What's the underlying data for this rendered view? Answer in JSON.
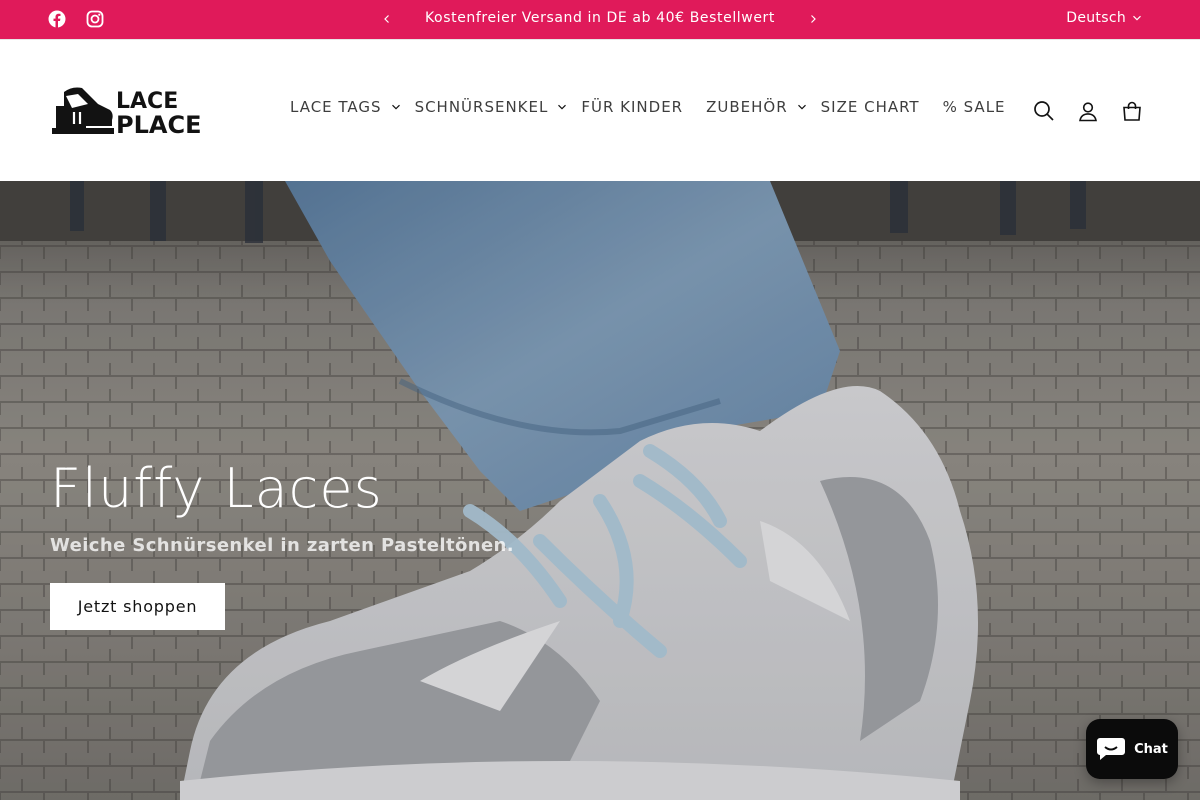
{
  "announcement": {
    "text": "Kostenfreier Versand in DE ab 40€ Bestellwert",
    "language": "Deutsch",
    "background_color": "#e01a5a"
  },
  "social": [
    "facebook-icon",
    "instagram-icon"
  ],
  "logo": {
    "line1": "LACE",
    "line2": "PLACE"
  },
  "nav": [
    {
      "label": "LACE TAGS",
      "has_dropdown": true
    },
    {
      "label": "SCHNÜRSENKEL",
      "has_dropdown": true
    },
    {
      "label": "FÜR KINDER",
      "has_dropdown": false
    },
    {
      "label": "ZUBEHÖR",
      "has_dropdown": true
    },
    {
      "label": "SIZE CHART",
      "has_dropdown": false
    },
    {
      "label": "% SALE",
      "has_dropdown": false
    }
  ],
  "header_icons": [
    "search-icon",
    "account-icon",
    "cart-icon"
  ],
  "hero": {
    "title": "Fluffy Laces",
    "subtitle": "Weiche Schnürsenkel in zarten Pasteltönen.",
    "button": "Jetzt shoppen"
  },
  "chat": {
    "label": "Chat"
  }
}
